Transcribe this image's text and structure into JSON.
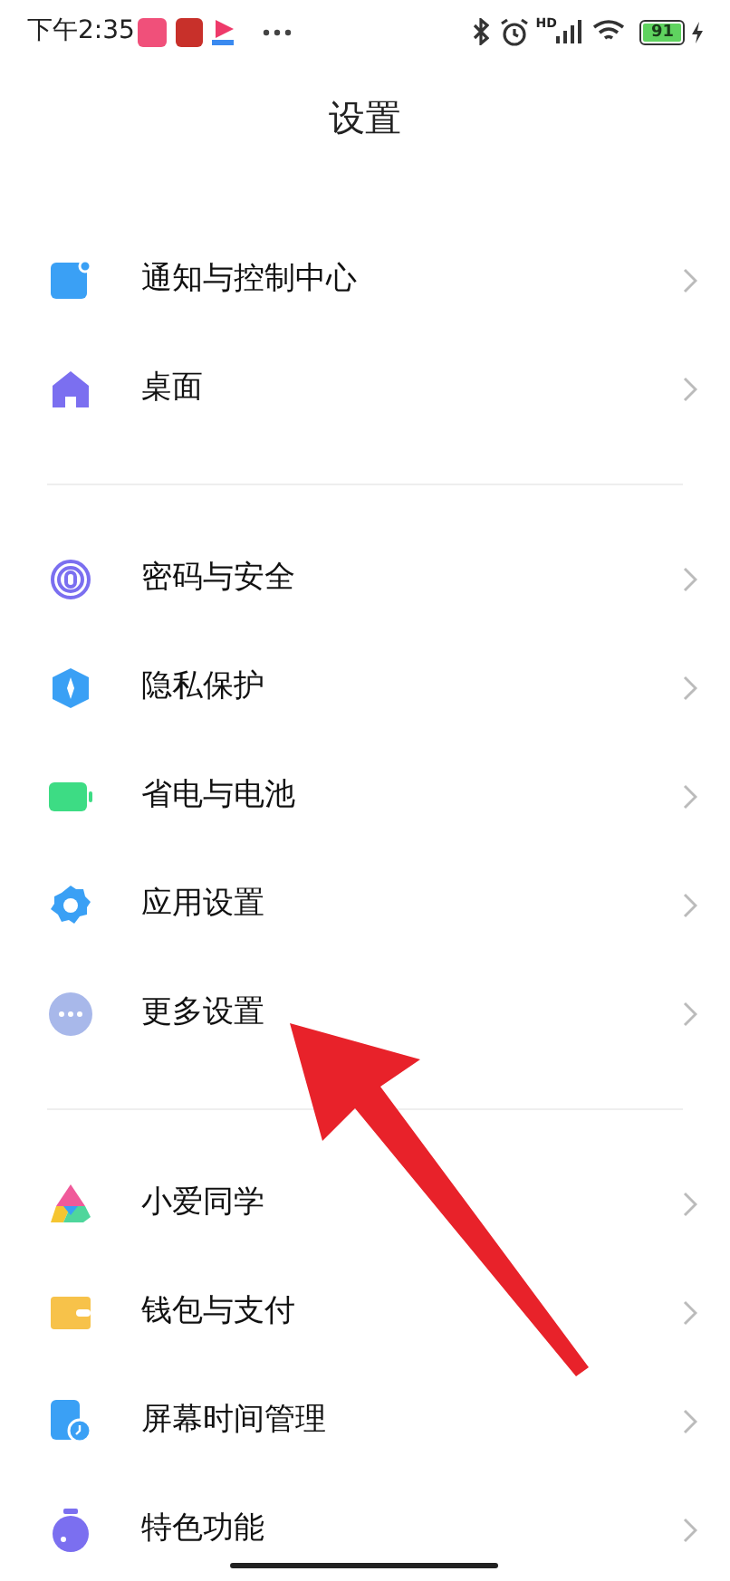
{
  "status_bar": {
    "time": "下午2:35",
    "network": "HD",
    "battery": "91"
  },
  "title": "设置",
  "groups": [
    [
      {
        "label": "通知与控制中心"
      },
      {
        "label": "桌面"
      }
    ],
    [
      {
        "label": "密码与安全"
      },
      {
        "label": "隐私保护"
      },
      {
        "label": "省电与电池"
      },
      {
        "label": "应用设置"
      },
      {
        "label": "更多设置"
      }
    ],
    [
      {
        "label": "小爱同学"
      },
      {
        "label": "钱包与支付"
      },
      {
        "label": "屏幕时间管理"
      },
      {
        "label": "特色功能"
      }
    ]
  ]
}
